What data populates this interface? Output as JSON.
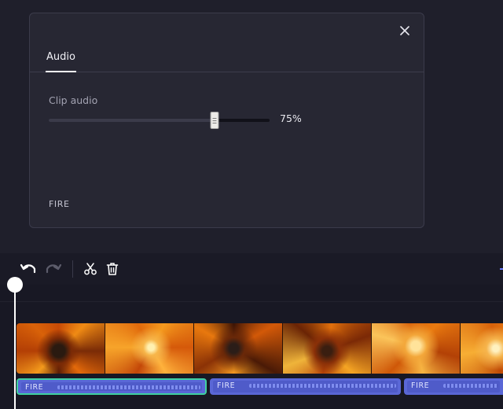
{
  "panel": {
    "tab_label": "Audio",
    "section_label": "Clip audio",
    "volume": {
      "value": 75,
      "label": "75%"
    },
    "clip_name": "FIRE"
  },
  "toolbar": {
    "tools": [
      {
        "icon": "undo-icon",
        "enabled": true
      },
      {
        "icon": "redo-icon",
        "enabled": false
      },
      {
        "icon": "scissors-icon",
        "enabled": true
      },
      {
        "icon": "trash-icon",
        "enabled": true
      }
    ]
  },
  "timeline": {
    "audio_clips": [
      {
        "label": "FIRE",
        "selected": true
      },
      {
        "label": "FIRE",
        "selected": false
      },
      {
        "label": "FIRE",
        "selected": false
      }
    ]
  },
  "colors": {
    "selected_clip_border": "#3fd1a1",
    "audio_clip": "#5a67d6",
    "accent": "#6c7cff"
  }
}
